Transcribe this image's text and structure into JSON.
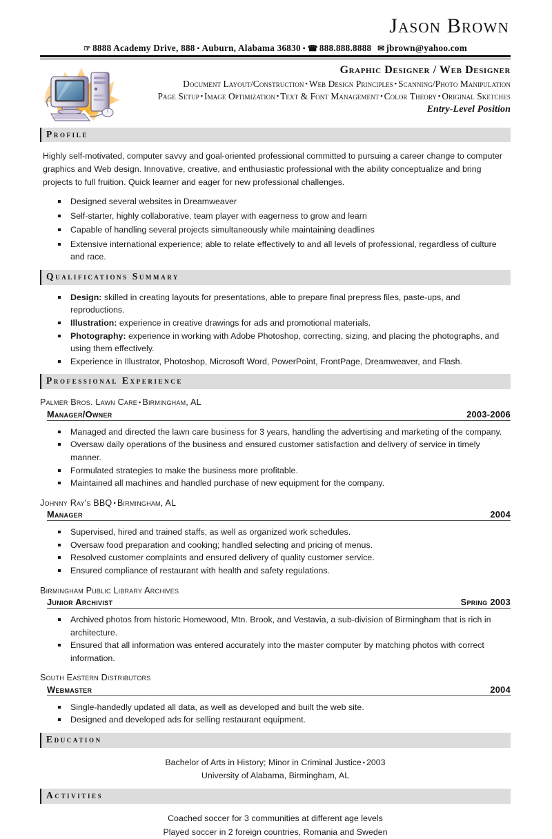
{
  "header": {
    "name": "Jason Brown",
    "address": "8888 Academy Drive, 888",
    "city_state_zip": "Auburn, Alabama 36830",
    "phone": "888.888.8888",
    "email": "jbrown@yahoo.com",
    "home_icon": "house-icon",
    "phone_icon": "telephone-icon",
    "email_icon": "envelope-icon"
  },
  "title_block": {
    "job_target": "Graphic Designer / Web Designer",
    "specialties_line1": [
      "Document Layout/Construction",
      "Web Design Principles",
      "Scanning/Photo Manipulation"
    ],
    "specialties_line2": [
      "Page Setup",
      "Image Optimization",
      "Text & Font Management",
      "Color Theory",
      "Original Sketches"
    ],
    "entry_level": "Entry-Level Position",
    "clipart": "desktop-computer-illustration"
  },
  "sections": {
    "profile": {
      "heading": "Profile",
      "paragraph": "Highly self-motivated, computer savvy and goal-oriented professional committed to pursuing a career change to computer graphics and Web design. Innovative, creative, and enthusiastic professional with the ability conceptualize and bring projects to full fruition.  Quick learner and eager for new professional challenges.",
      "bullets": [
        "Designed several websites in Dreamweaver",
        "Self-starter, highly collaborative, team player with eagerness to grow and learn",
        "Capable of handling several projects simultaneously while maintaining deadlines",
        "Extensive international experience; able to relate effectively to and all levels of professional, regardless of culture and race."
      ]
    },
    "qualifications": {
      "heading": "Qualifications Summary",
      "bullets": [
        {
          "lead": "Design:",
          "text": " skilled in creating layouts for presentations, able to prepare final prepress files, paste-ups, and reproductions."
        },
        {
          "lead": "Illustration:",
          "text": " experience in creative drawings for ads and promotional materials."
        },
        {
          "lead": "Photography:",
          "text": " experience in working with Adobe Photoshop, correcting, sizing, and placing the photographs, and using them effectively."
        },
        {
          "lead": "",
          "text": "Experience in Illustrator, Photoshop, Microsoft Word, PowerPoint, FrontPage, Dreamweaver, and Flash."
        }
      ]
    },
    "experience": {
      "heading": "Professional Experience",
      "jobs": [
        {
          "company": "Palmer Bros. Lawn Care",
          "location": "Birmingham, AL",
          "title": "Manager/Owner",
          "dates": "2003-2006",
          "bullets": [
            "Managed and directed the lawn care business for 3 years, handling the advertising and marketing of the company.",
            "Oversaw daily operations of the business and ensured customer satisfaction and delivery of service in timely manner.",
            "Formulated strategies to make the business more profitable.",
            "Maintained all machines and handled purchase of new equipment for the company."
          ]
        },
        {
          "company": "Johnny Ray's BBQ",
          "location": "Birmingham, AL",
          "title": "Manager",
          "dates": "2004",
          "bullets": [
            "Supervised, hired and trained staffs, as well as organized work schedules.",
            "Oversaw food preparation and cooking; handled selecting and pricing of menus.",
            "Resolved customer complaints and ensured delivery of quality customer service.",
            "Ensured compliance of restaurant with health and safety regulations."
          ]
        },
        {
          "company": "Birmingham Public Library Archives",
          "location": "",
          "title": "Junior Archivist",
          "dates": "Spring 2003",
          "bullets": [
            "Archived photos from historic Homewood, Mtn. Brook, and Vestavia, a sub-division of Birmingham that is rich in architecture.",
            "Ensured that all information was entered accurately into the master computer by matching photos with correct information."
          ]
        },
        {
          "company": "South Eastern Distributors",
          "location": "",
          "title": "Webmaster",
          "dates": "2004",
          "bullets": [
            "Single-handedly updated all data, as well as developed and built the web site.",
            "Designed and developed ads for selling restaurant equipment."
          ]
        }
      ]
    },
    "education": {
      "heading": "Education",
      "degree": "Bachelor of Arts in History; Minor in Criminal Justice",
      "year": "2003",
      "school": "University of Alabama, Birmingham, AL"
    },
    "activities": {
      "heading": "Activities",
      "lines": [
        "Coached soccer for 3 communities at different age levels",
        "Played soccer in 2 foreign countries, Romania and Sweden"
      ]
    }
  }
}
